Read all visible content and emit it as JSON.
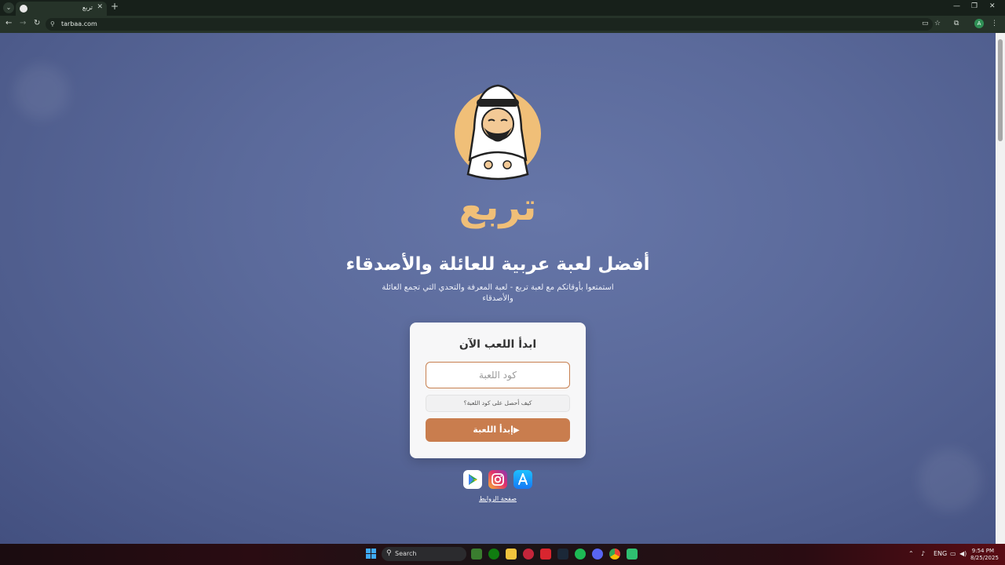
{
  "browser": {
    "tab_title": "تربع",
    "url": "tarbaa.com",
    "new_tab_symbol": "+",
    "close_symbol": "✕"
  },
  "page": {
    "logo_text": "تربع",
    "headline": "أفضل لعبة عربية للعائلة والأصدقاء",
    "subline": "استمتعوا بأوقاتكم مع لعبة تربع - لعبة المعرفة والتحدي التي تجمع العائلة والأصدقاء",
    "card": {
      "title": "ابدأ اللعب الآن",
      "code_placeholder": "كود اللعبة",
      "code_value": "",
      "help_label": "كيف أحصل على كود اللعبة؟",
      "start_label": "إبدأ اللعبة"
    },
    "stores": [
      "google-play",
      "instagram",
      "app-store"
    ],
    "links_label": "صفحة الروابط",
    "colors": {
      "accent": "#c97d4e",
      "logo": "#f0bf78",
      "background": "#5b6a9b"
    }
  },
  "taskbar": {
    "search_label": "Search",
    "language": "ENG",
    "time": "9:54 PM",
    "date": "8/25/2025"
  }
}
